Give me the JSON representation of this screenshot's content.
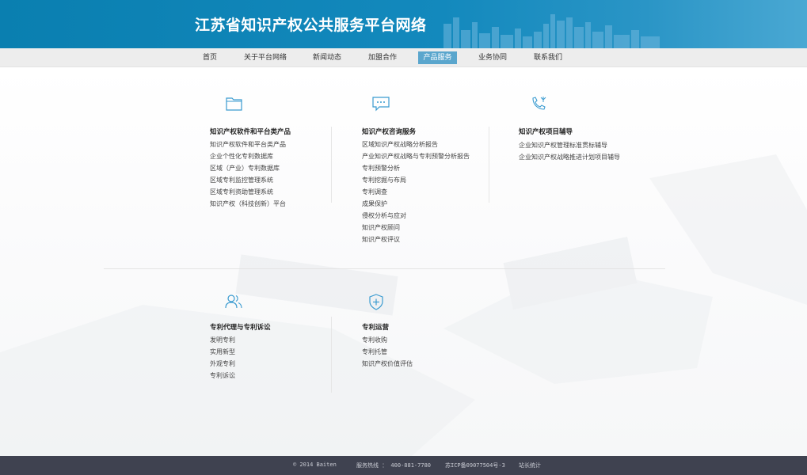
{
  "header": {
    "title": "江苏省知识产权公共服务平台网络"
  },
  "nav": {
    "items": [
      {
        "label": "首页"
      },
      {
        "label": "关于平台网络"
      },
      {
        "label": "新闻动态"
      },
      {
        "label": "加盟合作"
      },
      {
        "label": "产品服务"
      },
      {
        "label": "业务协同"
      },
      {
        "label": "联系我们"
      }
    ],
    "active": "产品服务"
  },
  "sections": [
    {
      "icon": "folder-icon",
      "title": "知识产权软件和平台类产品",
      "items": [
        "知识产权软件和平台类产品",
        "企业个性化专利数据库",
        "区域（产业）专利数据库",
        "区域专利监控管理系统",
        "区域专利资助管理系统",
        "知识产权（科技创新）平台"
      ]
    },
    {
      "icon": "chat-icon",
      "title": "知识产权咨询服务",
      "items": [
        "区域知识产权战略分析报告",
        "产业知识产权战略与专利预警分析报告",
        "专利预警分析",
        "专利挖掘与布局",
        "专利调查",
        "成果保护",
        "侵权分析与应对",
        "知识产权顾问",
        "知识产权评议"
      ]
    },
    {
      "icon": "phone-icon",
      "title": "知识产权项目辅导",
      "items": [
        "企业知识产权管理标准贯标辅导",
        "企业知识产权战略推进计划项目辅导"
      ]
    },
    {
      "icon": "users-icon",
      "title": "专利代理与专利诉讼",
      "items": [
        "发明专利",
        "实用新型",
        "外观专利",
        "专利诉讼"
      ]
    },
    {
      "icon": "shield-plus-icon",
      "title": "专利运营",
      "items": [
        "专利收购",
        "专利托管",
        "知识产权价值评估"
      ]
    }
  ],
  "footer": {
    "copyright": "© 2014  Baiten",
    "hotline": "服务热线 ： 400-881-7780",
    "icp": "苏ICP备09077504号-3",
    "stats": "站长统计"
  },
  "colors": {
    "header": "#0a7fb0",
    "nav_active": "#5aa6cd",
    "icon": "#3a9bd0",
    "footer": "#3f4250"
  }
}
